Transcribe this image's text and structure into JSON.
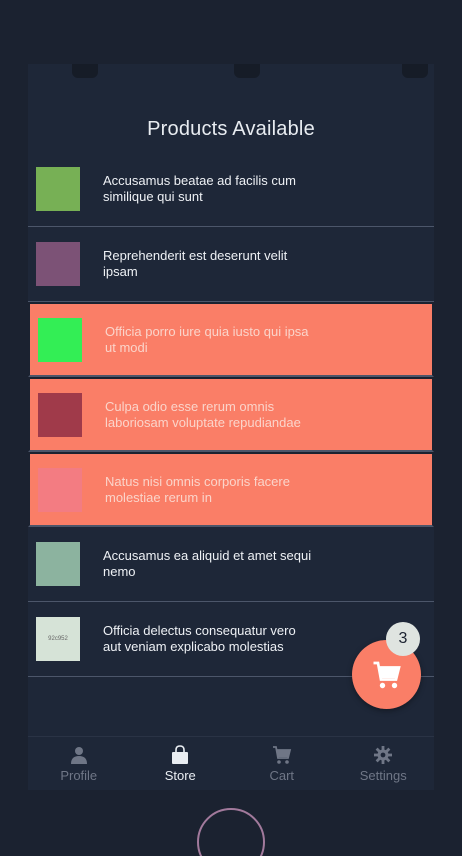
{
  "header": {
    "title": "Products Available"
  },
  "products": [
    {
      "name": "Accusamus beatae ad facilis cum similique qui sunt",
      "color": "#77b055",
      "selected": false,
      "thumb_text": ""
    },
    {
      "name": "Reprehenderit est deserunt velit ipsam",
      "color": "#7c5276",
      "selected": false,
      "thumb_text": ""
    },
    {
      "name": "Officia porro iure quia iusto qui ipsa ut modi",
      "color": "#33ee55",
      "selected": true,
      "thumb_text": ""
    },
    {
      "name": "Culpa odio esse rerum omnis laboriosam voluptate repudiandae",
      "color": "#a03a4a",
      "selected": true,
      "thumb_text": ""
    },
    {
      "name": "Natus nisi omnis corporis facere molestiae rerum in",
      "color": "#f37c82",
      "selected": true,
      "thumb_text": ""
    },
    {
      "name": "Accusamus ea aliquid et amet sequi nemo",
      "color": "#8cb39f",
      "selected": false,
      "thumb_text": ""
    },
    {
      "name": "Officia delectus consequatur vero aut veniam explicabo molestias",
      "color": "#d6e3d7",
      "selected": false,
      "thumb_text": "92c952"
    }
  ],
  "cart": {
    "count": "3",
    "icon": "cart-icon"
  },
  "tabs": [
    {
      "label": "Profile",
      "icon": "person-icon",
      "active": false
    },
    {
      "label": "Store",
      "icon": "bag-icon",
      "active": true
    },
    {
      "label": "Cart",
      "icon": "cart-icon",
      "active": false
    },
    {
      "label": "Settings",
      "icon": "gear-icon",
      "active": false
    }
  ],
  "colors": {
    "accent": "#fa7e67",
    "background": "#1e2738",
    "divider": "#4c566a"
  }
}
